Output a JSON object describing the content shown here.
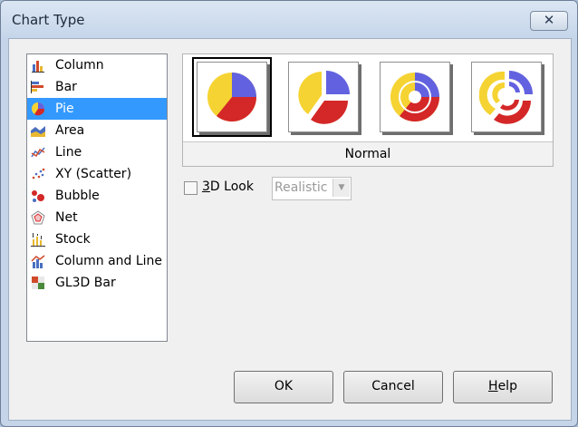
{
  "dialog": {
    "title": "Chart Type",
    "close_glyph": "✕"
  },
  "chart_types": [
    {
      "label": "Column",
      "icon": "column-chart-icon"
    },
    {
      "label": "Bar",
      "icon": "bar-chart-icon"
    },
    {
      "label": "Pie",
      "icon": "pie-chart-icon",
      "selected": true
    },
    {
      "label": "Area",
      "icon": "area-chart-icon"
    },
    {
      "label": "Line",
      "icon": "line-chart-icon"
    },
    {
      "label": "XY (Scatter)",
      "icon": "scatter-chart-icon"
    },
    {
      "label": "Bubble",
      "icon": "bubble-chart-icon"
    },
    {
      "label": "Net",
      "icon": "net-chart-icon"
    },
    {
      "label": "Stock",
      "icon": "stock-chart-icon"
    },
    {
      "label": "Column and Line",
      "icon": "column-and-line-chart-icon"
    },
    {
      "label": "GL3D Bar",
      "icon": "gl3d-bar-chart-icon"
    }
  ],
  "variants": {
    "items": [
      "pie-normal-icon",
      "pie-exploded-icon",
      "donut-icon",
      "donut-exploded-icon"
    ],
    "selected_label": "Normal"
  },
  "look": {
    "checkbox_label_mnemonic": "3",
    "checkbox_label_rest": "D Look",
    "checked": false,
    "select_value": "Realistic",
    "select_arrow": "▼"
  },
  "buttons": {
    "ok": "OK",
    "cancel": "Cancel",
    "help_mnemonic": "H",
    "help_rest": "elp"
  },
  "colors": {
    "selection": "#3399ff",
    "pie_blue": "#6262e0",
    "pie_red": "#d42727",
    "pie_yellow": "#f5d332"
  }
}
